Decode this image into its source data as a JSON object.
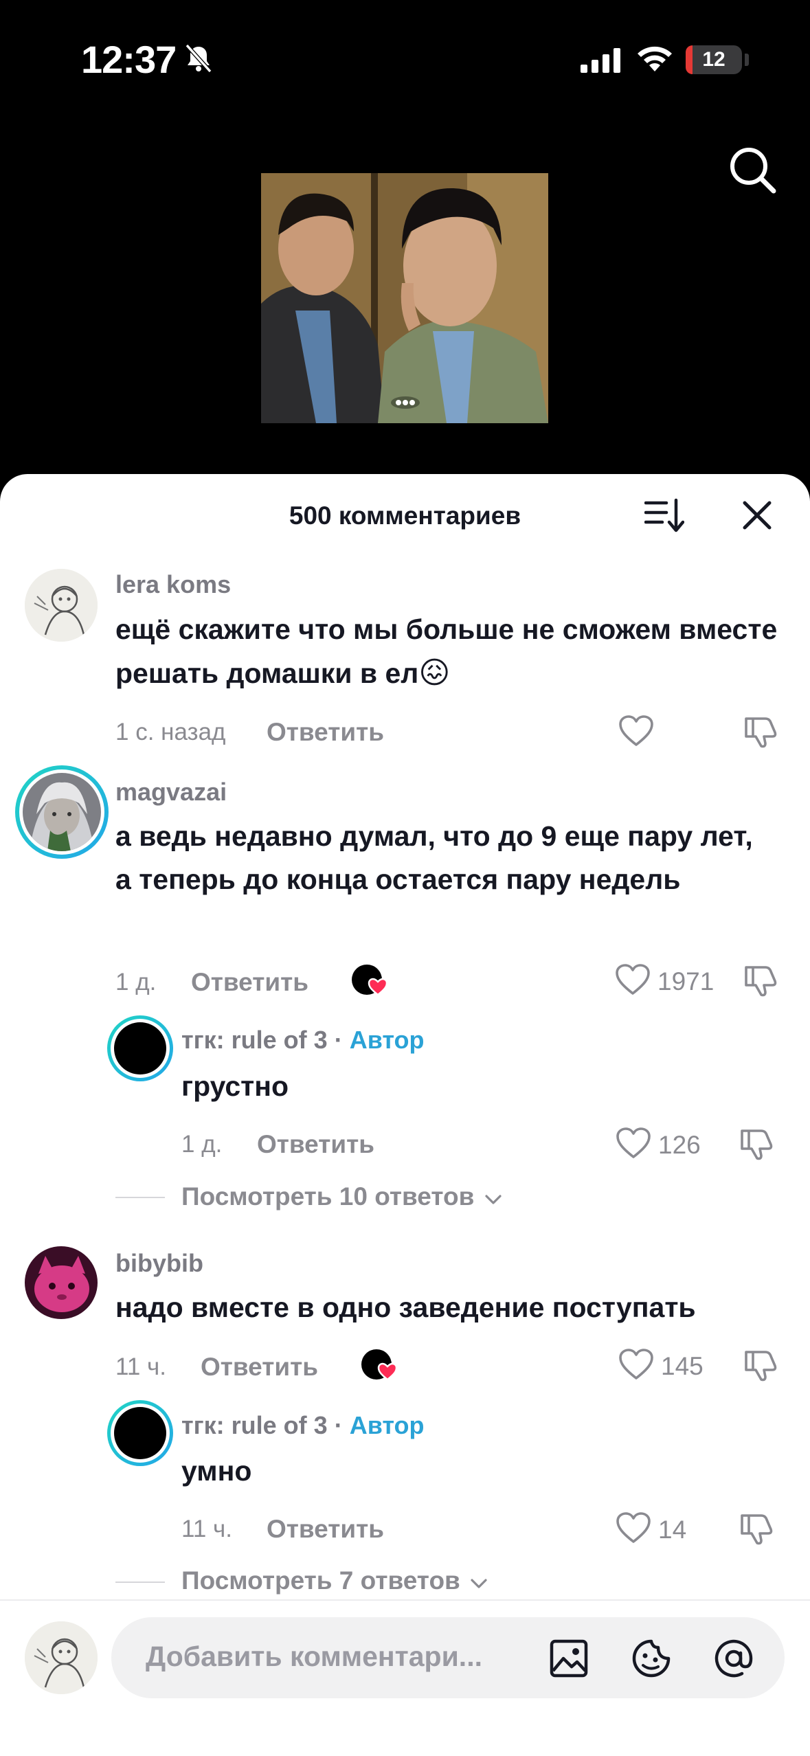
{
  "status_bar": {
    "time": "12:37",
    "battery": "12",
    "battery_level": 0.12,
    "icons": [
      "mute-bell-icon",
      "signal-icon",
      "wifi-icon",
      "battery-icon"
    ]
  },
  "header": {
    "comment_count_title": "500 комментариев",
    "icons": [
      "search-icon",
      "sort-icon",
      "close-icon"
    ]
  },
  "colors": {
    "author_tag": "#2aa2d6",
    "creator_like_heart": "#fe2c55",
    "text_primary": "#161823",
    "text_secondary": "#8a8a90"
  },
  "comments": [
    {
      "username": "lera koms",
      "text": "ещё скажите что мы больше не сможем вместе решать домашки в ел",
      "emoji": "😖",
      "time": "1 с. назад",
      "reply_label": "Ответить",
      "likes": ""
    },
    {
      "username": "magvazai",
      "text": "а ведь недавно думал, что до 9 еще пару лет, а теперь до конца остается пару недель",
      "time": "1 д.",
      "reply_label": "Ответить",
      "likes": "1971",
      "reply": {
        "username": "тгк:  rule of 3",
        "separator": "·",
        "author_label": "Автор",
        "text": "грустно",
        "time": "1 д.",
        "reply_label": "Ответить",
        "likes": "126"
      },
      "view_replies": "Посмотреть 10 ответов"
    },
    {
      "username": "bibybib",
      "text": "надо вместе в одно заведение поступать",
      "time": "11 ч.",
      "reply_label": "Ответить",
      "likes": "145",
      "reply": {
        "username": "тгк:  rule of 3",
        "separator": "·",
        "author_label": "Автор",
        "text": "умно",
        "time": "11 ч.",
        "reply_label": "Ответить",
        "likes": "14"
      },
      "view_replies": "Посмотреть 7 ответов"
    }
  ],
  "input_bar": {
    "placeholder": "Добавить комментари...",
    "icons": [
      "image-icon",
      "emoji-icon",
      "mention-icon"
    ]
  }
}
